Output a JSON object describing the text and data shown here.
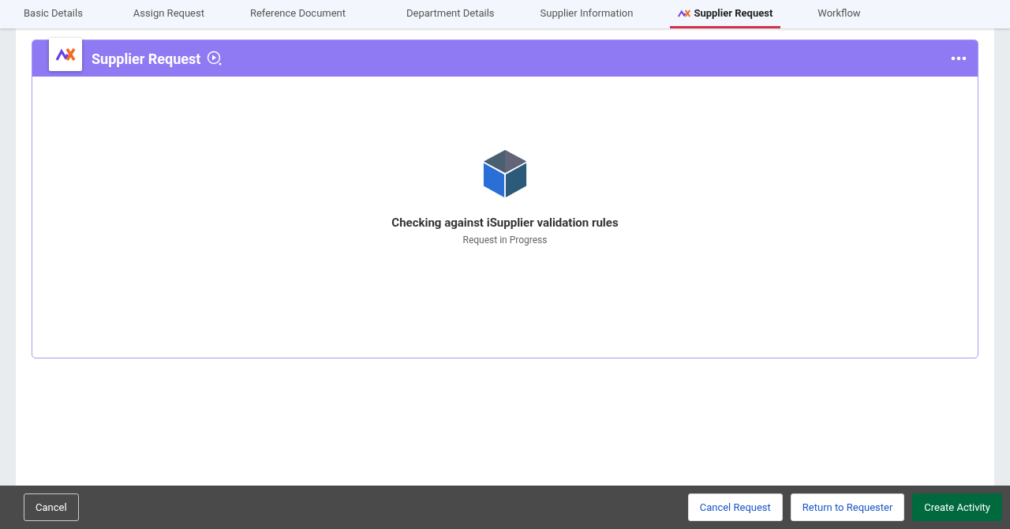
{
  "tabs": [
    {
      "label": "Basic Details",
      "selected": false
    },
    {
      "label": "Assign Request",
      "selected": false
    },
    {
      "label": "Reference Document",
      "selected": false
    },
    {
      "label": "Department Details",
      "selected": false
    },
    {
      "label": "Supplier Information",
      "selected": false
    },
    {
      "label": "Supplier Request",
      "selected": true
    },
    {
      "label": "Workflow",
      "selected": false
    }
  ],
  "card": {
    "title": "Supplier Request",
    "status_title": "Checking against iSupplier validation rules",
    "status_subtitle": "Request in Progress"
  },
  "footer": {
    "left_buttons": [
      {
        "label": "Cancel",
        "kind": "outline"
      }
    ],
    "right_buttons": [
      {
        "label": "Cancel Request",
        "kind": "light"
      },
      {
        "label": "Return to Requester",
        "kind": "light"
      },
      {
        "label": "Create Activity",
        "kind": "primary"
      }
    ]
  }
}
